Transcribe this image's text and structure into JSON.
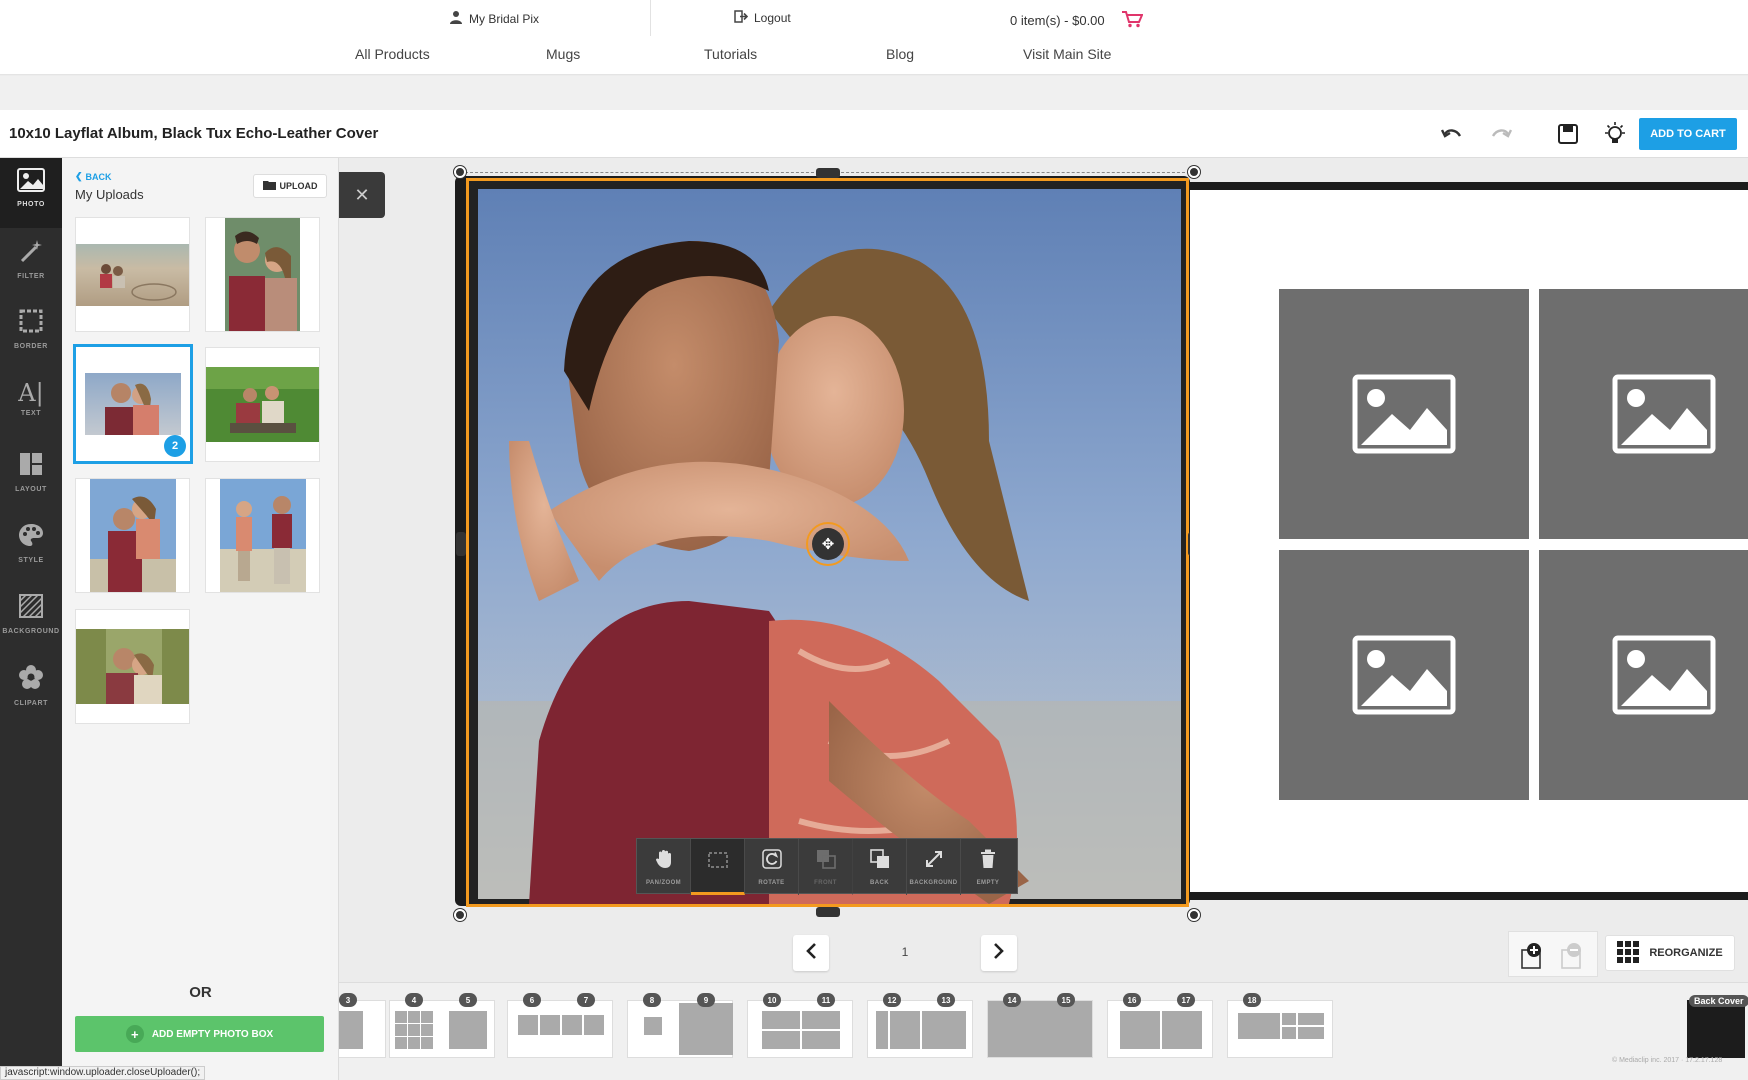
{
  "top_bar": {
    "account_label": "My Bridal Pix",
    "logout_label": "Logout",
    "cart_summary": "0 item(s) - $0.00",
    "nav": [
      "All Products",
      "Mugs",
      "Tutorials",
      "Blog",
      "Visit Main Site"
    ]
  },
  "title_bar": {
    "title": "10x10 Layflat Album, Black Tux Echo-Leather Cover",
    "add_to_cart_label": "ADD TO CART",
    "icons": [
      "undo-icon",
      "redo-icon",
      "save-icon",
      "lightbulb-icon"
    ]
  },
  "tool_rail": {
    "items": [
      {
        "label": "PHOTO",
        "icon": "image-icon",
        "active": true
      },
      {
        "label": "FILTER",
        "icon": "magic-wand-icon"
      },
      {
        "label": "BORDER",
        "icon": "border-icon"
      },
      {
        "label": "TEXT",
        "icon": "text-icon"
      },
      {
        "label": "LAYOUT",
        "icon": "layout-icon"
      },
      {
        "label": "STYLE",
        "icon": "palette-icon"
      },
      {
        "label": "BACKGROUND",
        "icon": "background-icon"
      },
      {
        "label": "CLIPART",
        "icon": "flower-icon"
      }
    ]
  },
  "uploads_panel": {
    "back_label": "BACK",
    "heading": "My Uploads",
    "upload_label": "UPLOAD",
    "selected_badge": "2",
    "or_label": "OR",
    "add_empty_label": "ADD EMPTY PHOTO BOX"
  },
  "photo_toolbar": {
    "tools": [
      {
        "label": "PAN/ZOOM",
        "icon": "hand-icon"
      },
      {
        "label": "",
        "icon": "crop-icon",
        "active": true
      },
      {
        "label": "ROTATE",
        "icon": "rotate-icon"
      },
      {
        "label": "FRONT",
        "icon": "bring-front-icon",
        "disabled": true
      },
      {
        "label": "BACK",
        "icon": "send-back-icon"
      },
      {
        "label": "BACKGROUND",
        "icon": "expand-icon"
      },
      {
        "label": "EMPTY",
        "icon": "trash-icon"
      }
    ]
  },
  "pager": {
    "page": "1"
  },
  "reorganize_label": "REORGANIZE",
  "page_strip": {
    "spreads": [
      [
        "3"
      ],
      [
        "4",
        "5"
      ],
      [
        "6",
        "7"
      ],
      [
        "8",
        "9"
      ],
      [
        "10",
        "11"
      ],
      [
        "12",
        "13"
      ],
      [
        "14",
        "15"
      ],
      [
        "16",
        "17"
      ],
      [
        "18"
      ]
    ],
    "back_cover_label": "Back Cover"
  },
  "status_bar": "javascript:window.uploader.closeUploader();",
  "copyright": "© Mediaclip inc. 2017 · 17.2.17.128",
  "colors": {
    "accent": "#1d9fe5",
    "selection": "#f39a1f",
    "add_button": "#5cc46b",
    "rail": "#2d2d2d"
  }
}
